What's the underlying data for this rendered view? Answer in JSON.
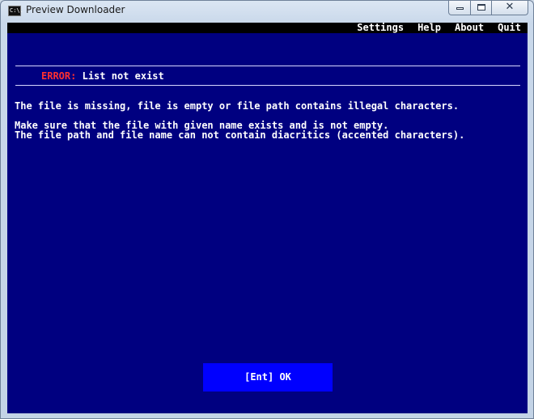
{
  "window": {
    "title": "Preview Downloader",
    "icon_text": "C:\\.",
    "controls": {
      "minimize": "minimize-icon",
      "maximize": "maximize-icon",
      "close": "✕"
    }
  },
  "menu": {
    "items": [
      "Settings",
      "Help",
      "About",
      "Quit"
    ]
  },
  "error": {
    "label": "ERROR:",
    "message": "List not exist"
  },
  "body": {
    "line1": "The file is missing, file is empty or file path contains illegal characters.",
    "line2": "Make sure that the file with given name exists and is not empty.",
    "line3": "The file path and file name can not contain diacritics (accented characters)."
  },
  "button": {
    "ok_label": "[Ent] OK"
  },
  "colors": {
    "console_bg": "#000080",
    "menubar_bg": "#000000",
    "error_label": "#ff3030",
    "button_bg": "#0000ff"
  }
}
